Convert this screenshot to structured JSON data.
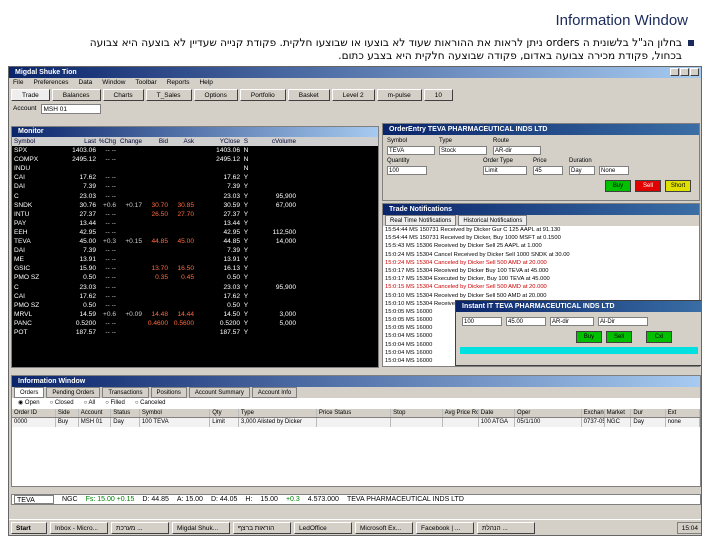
{
  "slide": {
    "title": "Information Window",
    "body": "בחלון הנ\"ל בלשונית ה orders ניתן לראות את ההוראות שעוד לא בוצעו או שבוצעו חלקית. פקודת קנייה שעדיין לא בוצעה היא צבועה בכחול, פקודת מכירה צבועה באדום, פקודה שבוצעה חלקית היא בצבע כתום."
  },
  "app": {
    "title": "Migdal Shuke Tion",
    "menu": [
      "File",
      "Preferences",
      "Data",
      "Window",
      "Toolbar",
      "Reports",
      "Help"
    ],
    "tabs": [
      "Trade",
      "Balances",
      "Charts",
      "T_Sales",
      "Options",
      "Portfolio",
      "Basket",
      "Level 2",
      "m-pulse",
      "10"
    ],
    "account_label": "Account",
    "account_value": "MSH 01"
  },
  "monitor": {
    "title": "Monitor",
    "headers": [
      "Symbol",
      "Last",
      "%Chg",
      "Change",
      "Bid",
      "Ask",
      "YClose",
      "S",
      "cVolume"
    ],
    "rows": [
      [
        "SPX",
        "1403.06",
        "-- --",
        "",
        "",
        "",
        "1403.06",
        "N",
        ""
      ],
      [
        "COMPX",
        "2495.12",
        "-- --",
        "",
        "",
        "",
        "2495.12",
        "N",
        ""
      ],
      [
        "INDU",
        "",
        "",
        "",
        "",
        "",
        "",
        "N",
        ""
      ],
      [
        "CAI",
        "17.62",
        "-- --",
        "",
        "",
        "",
        "17.62",
        "Y",
        ""
      ],
      [
        "DAI",
        "7.39",
        "-- --",
        "",
        "",
        "",
        "7.39",
        "Y",
        ""
      ],
      [
        "C",
        "23.03",
        "-- --",
        "",
        "",
        "",
        "23.03",
        "Y",
        "95,900"
      ],
      [
        "SNDK",
        "30.76",
        "+0.6",
        "+0.17",
        "30.70",
        "30.85",
        "30.59",
        "Y",
        "67,000"
      ],
      [
        "INTU",
        "27.37",
        "-- --",
        "",
        "26.50",
        "27.70",
        "27.37",
        "Y",
        ""
      ],
      [
        "PAY",
        "13.44",
        "-- --",
        "",
        "",
        "",
        "13.44",
        "Y",
        ""
      ],
      [
        "EEH",
        "42.95",
        "-- --",
        "",
        "",
        "",
        "42.95",
        "Y",
        "112,500"
      ],
      [
        "TEVA",
        "45.00",
        "+0.3",
        "+0.15",
        "44.85",
        "45.00",
        "44.85",
        "Y",
        "14,000"
      ],
      [
        "DAI",
        "7.39",
        "-- --",
        "",
        "",
        "",
        "7.39",
        "Y",
        ""
      ],
      [
        "ME",
        "13.91",
        "-- --",
        "",
        "",
        "",
        "13.91",
        "Y",
        ""
      ],
      [
        "GSIC",
        "15.90",
        "-- --",
        "",
        "13.70",
        "16.50",
        "16.13",
        "Y",
        ""
      ],
      [
        "PMO SZ",
        "0.50",
        "-- --",
        "",
        "0.35",
        "0.45",
        "0.50",
        "Y",
        ""
      ],
      [
        "C",
        "23.03",
        "-- --",
        "",
        "",
        "",
        "23.03",
        "Y",
        "95,900"
      ],
      [
        "CAI",
        "17.62",
        "-- --",
        "",
        "",
        "",
        "17.62",
        "Y",
        ""
      ],
      [
        "PMO SZ",
        "0.50",
        "-- --",
        "",
        "",
        "",
        "0.50",
        "Y",
        ""
      ],
      [
        "MRVL",
        "14.59",
        "+0.6",
        "+0.09",
        "14.48",
        "14.44",
        "14.50",
        "Y",
        "3,000"
      ],
      [
        "PANC",
        "0.5200",
        "-- --",
        "",
        "0.4600",
        "0.5600",
        "0.5200",
        "Y",
        "5,000"
      ],
      [
        "POT",
        "187.57",
        "-- --",
        "",
        "",
        "",
        "187.57",
        "Y",
        ""
      ]
    ]
  },
  "order_entry": {
    "title": "OrderEntry   TEVA PHARMACEUTICAL INDS LTD",
    "labels": [
      "Symbol",
      "Type",
      "Route",
      "Quantity",
      "Order Type",
      "Price",
      "Duration"
    ],
    "values": [
      "TEVA",
      "Stock",
      "AR-dir",
      "100",
      "Limit",
      "45",
      "Day",
      "None"
    ],
    "buttons": [
      "Buy",
      "Sell",
      "Short"
    ]
  },
  "trade_notifications": {
    "title": "Trade Notifications",
    "tabs": [
      "Real Time Notifications",
      "Historical Notifications"
    ],
    "lines": [
      "15:54:44 MS 150731 Received by Dicker Gur C 125 AAPL at 91.130",
      "15:54:44 MS 150731 Received by Dicker, Buy 1000 MSFT at 0.1500",
      "15:5:43 MS 15306 Received by Dicker Sell 25 AAPL at 1.000",
      "15:0:24 MS 15304 Cancel Received by Dicker Sell 1000 SNDK at 30.00",
      "15:0:24 MS 15304 Canceled by Dicker Sell 500 AMD at 20.000",
      "15:0:17 MS 15304 Received by Dicker Buy 100 TEVA at 45.000",
      "15:0:17 MS 15304 Executed by Dicker, Buy 100 TEVA at 45.000",
      "15:0:15 MS 15304 Canceled by Dicker Sell 500 AMD at 20.000",
      "15:0:10 MS 15304 Received by Dicker Sell 500 AMD at 20.000",
      "15:0:10 MS 15304 Received by Dicker, Buy 100 SNDK at 30.00",
      "15:0:05 MS 16000",
      "15:0:05 MS 16000",
      "15:0:05 MS 16000",
      "15:0:04 MS 16000",
      "15:0:04 MS 16000",
      "15:0:04 MS 16000",
      "15:0:04 MS 16000"
    ],
    "red_indices": [
      4,
      7
    ]
  },
  "popup": {
    "title": "Instant IT   TEVA PHARMACEUTICAL INDS LTD",
    "fields": [
      "100",
      "45.00",
      "AR-dir",
      "Al-Dir"
    ],
    "buttons": [
      "Buy",
      "Sell",
      "Cxl"
    ]
  },
  "info": {
    "title": "Information Window",
    "tabs": [
      "Orders",
      "Pending Orders",
      "Transactions",
      "Positions",
      "Account Summary",
      "Account Info"
    ],
    "radios": [
      "Open",
      "Closed",
      "All",
      "Filled",
      "Canceled"
    ],
    "headers": [
      "Order ID",
      "Side",
      "Account",
      "Status",
      "Symbol",
      "Qty",
      "Type",
      "Price Status",
      "Stop",
      "Avg Price Routed",
      "Date",
      "Oper",
      "Exchange Order ID",
      "Market",
      "Dur",
      "Ext"
    ],
    "rows": [
      [
        "0000",
        "Buy",
        "MSH 01",
        "Day",
        "100 TEVA",
        "Limit",
        "3,000 Alisted by Dicker",
        "",
        "",
        "",
        "100 ATGA",
        "05/1/100",
        "0737-050-IPO-CIO",
        "NGC",
        "Day",
        "none"
      ]
    ]
  },
  "ticker": {
    "symbol": "TEVA",
    "items": [
      "NGC",
      "Fs: 15.00 +0.15",
      "D: 44.85",
      "A: 15.00",
      "D: 44.05",
      "H:",
      "15.00",
      "+0.3",
      "4.573.000",
      "TEVA PHARMACEUTICAL INDS LTD"
    ]
  },
  "taskbar": {
    "start": "Start",
    "tasks": [
      "Inbox - Micro...",
      "מערכת ...",
      "Migdal Shuk...",
      "הוראות ברצף",
      "LedOffice",
      "Microsoft Ex...",
      "Facebook | ...",
      "הנהלת ..."
    ],
    "clock": "15:04"
  }
}
